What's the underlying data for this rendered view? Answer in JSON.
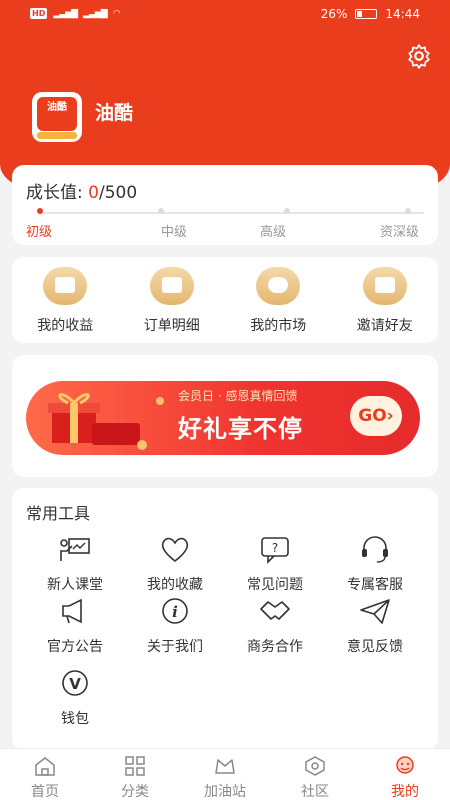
{
  "status_bar": {
    "left": "HD",
    "battery": "26%",
    "time": "14:44"
  },
  "profile": {
    "username": "油酷",
    "avatar_text": "油酷"
  },
  "growth": {
    "label": "成长值: ",
    "current": "0",
    "max": "/500",
    "progress": 0,
    "levels": [
      "初级",
      "中级",
      "高级",
      "资深级"
    ]
  },
  "quick_actions": [
    {
      "label": "我的收益",
      "icon": "wallet-icon"
    },
    {
      "label": "订单明细",
      "icon": "order-icon"
    },
    {
      "label": "我的市场",
      "icon": "market-icon"
    },
    {
      "label": "邀请好友",
      "icon": "gift-icon"
    }
  ],
  "banner": {
    "title": "会员日 · 感恩真情回馈",
    "main": "好礼享不停",
    "button": "GO›"
  },
  "tools": {
    "title": "常用工具",
    "items": [
      {
        "label": "新人课堂",
        "icon": "classroom-icon"
      },
      {
        "label": "我的收藏",
        "icon": "heart-icon"
      },
      {
        "label": "常见问题",
        "icon": "faq-icon"
      },
      {
        "label": "专属客服",
        "icon": "headset-icon"
      },
      {
        "label": "官方公告",
        "icon": "megaphone-icon"
      },
      {
        "label": "关于我们",
        "icon": "info-icon"
      },
      {
        "label": "商务合作",
        "icon": "handshake-icon"
      },
      {
        "label": "意见反馈",
        "icon": "paper-plane-icon"
      },
      {
        "label": "钱包",
        "icon": "wallet-v-icon"
      }
    ]
  },
  "tabbar": [
    {
      "label": "首页",
      "icon": "home-icon"
    },
    {
      "label": "分类",
      "icon": "grid-icon"
    },
    {
      "label": "加油站",
      "icon": "station-icon"
    },
    {
      "label": "社区",
      "icon": "community-icon"
    },
    {
      "label": "我的",
      "icon": "profile-icon",
      "active": true
    }
  ],
  "colors": {
    "brand": "#e93d1e",
    "gold": "#e4b770"
  }
}
